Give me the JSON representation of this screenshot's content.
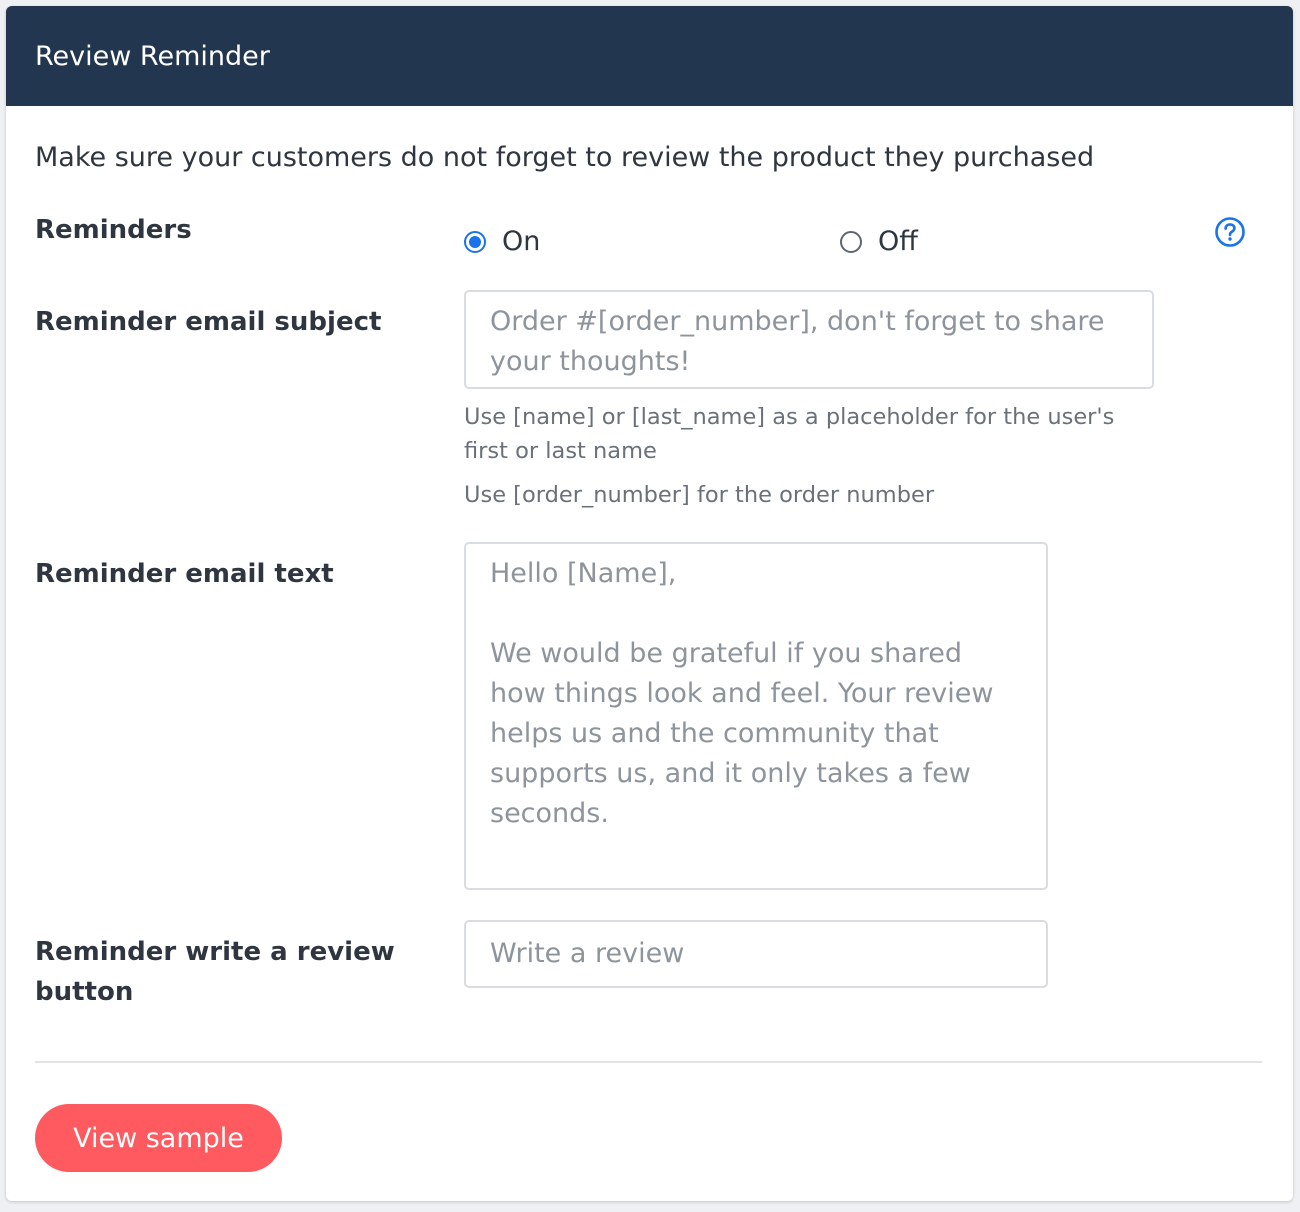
{
  "header": {
    "title": "Review Reminder"
  },
  "intro": "Make sure your customers do not forget to review the product they purchased",
  "reminders": {
    "label": "Reminders",
    "options": [
      {
        "label": "On",
        "checked": true
      },
      {
        "label": "Off",
        "checked": false
      }
    ],
    "help_icon": "question-circle-icon"
  },
  "subject": {
    "label": "Reminder email subject",
    "value": "Order #[order_number], don't forget to share your thoughts!",
    "hint_1": "Use [name] or [last_name] as a placeholder for the user's first or last name",
    "hint_2": "Use [order_number] for the order number"
  },
  "email_text": {
    "label": "Reminder email text",
    "value": "Hello [Name],\n\nWe would be grateful if you shared how things look and feel. Your review helps us and the community that supports us, and it only takes a few seconds."
  },
  "review_button": {
    "label": "Reminder write a review button",
    "placeholder": "Write a review"
  },
  "actions": {
    "view_sample": "View sample"
  },
  "colors": {
    "header_bg": "#22364f",
    "accent": "#1a73e8",
    "button_bg": "#ff5a5f"
  }
}
